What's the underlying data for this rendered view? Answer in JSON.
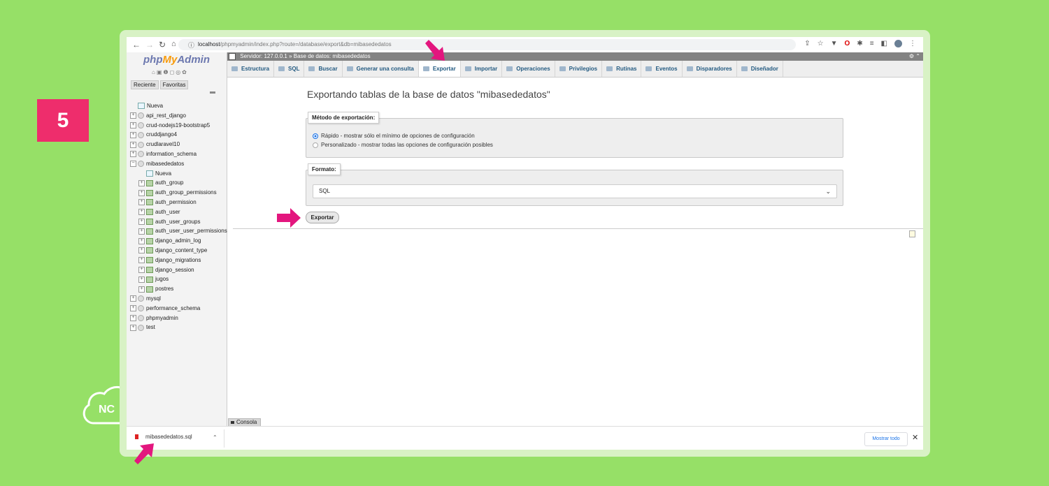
{
  "step_number": "5",
  "brand": {
    "logo_text": "NC"
  },
  "browser": {
    "url_host": "localhost",
    "url_path": "/phpmyadmin/index.php?route=/database/export&db=mibasededatos"
  },
  "sidebar": {
    "logo_php": "php",
    "logo_my": "My",
    "logo_admin": "Admin",
    "tabs": [
      "Reciente",
      "Favoritas"
    ],
    "tree": [
      {
        "label": "Nueva",
        "kind": "new",
        "level": 0
      },
      {
        "label": "api_rest_django",
        "kind": "db",
        "level": 0
      },
      {
        "label": "crud-nodejs19-bootstrap5",
        "kind": "db",
        "level": 0
      },
      {
        "label": "cruddjango4",
        "kind": "db",
        "level": 0
      },
      {
        "label": "crudlaravel10",
        "kind": "db",
        "level": 0
      },
      {
        "label": "information_schema",
        "kind": "db",
        "level": 0
      },
      {
        "label": "mibasededatos",
        "kind": "db",
        "level": 0,
        "expanded": true
      },
      {
        "label": "Nueva",
        "kind": "new",
        "level": 1
      },
      {
        "label": "auth_group",
        "kind": "table",
        "level": 1
      },
      {
        "label": "auth_group_permissions",
        "kind": "table",
        "level": 1
      },
      {
        "label": "auth_permission",
        "kind": "table",
        "level": 1
      },
      {
        "label": "auth_user",
        "kind": "table",
        "level": 1
      },
      {
        "label": "auth_user_groups",
        "kind": "table",
        "level": 1
      },
      {
        "label": "auth_user_user_permissions",
        "kind": "table",
        "level": 1
      },
      {
        "label": "django_admin_log",
        "kind": "table",
        "level": 1
      },
      {
        "label": "django_content_type",
        "kind": "table",
        "level": 1
      },
      {
        "label": "django_migrations",
        "kind": "table",
        "level": 1
      },
      {
        "label": "django_session",
        "kind": "table",
        "level": 1
      },
      {
        "label": "jugos",
        "kind": "table",
        "level": 1
      },
      {
        "label": "postres",
        "kind": "table",
        "level": 1
      },
      {
        "label": "mysql",
        "kind": "db",
        "level": 0
      },
      {
        "label": "performance_schema",
        "kind": "db",
        "level": 0
      },
      {
        "label": "phpmyadmin",
        "kind": "db",
        "level": 0
      },
      {
        "label": "test",
        "kind": "db",
        "level": 0
      }
    ]
  },
  "breadcrumb": {
    "server": "Servidor: 127.0.0.1",
    "separator": "»",
    "database": "Base de datos: mibasededatos"
  },
  "tabs": [
    "Estructura",
    "SQL",
    "Buscar",
    "Generar una consulta",
    "Exportar",
    "Importar",
    "Operaciones",
    "Privilegios",
    "Rutinas",
    "Eventos",
    "Disparadores",
    "Diseñador"
  ],
  "active_tab": "Exportar",
  "main": {
    "title": "Exportando tablas de la base de datos \"mibasededatos\"",
    "method_legend": "Método de exportación:",
    "options": [
      {
        "label": "Rápido - mostrar sólo el mínimo de opciones de configuración",
        "checked": true
      },
      {
        "label": "Personalizado - mostrar todas las opciones de configuración posibles",
        "checked": false
      }
    ],
    "format_legend": "Formato:",
    "format_value": "SQL",
    "export_button": "Exportar"
  },
  "console_label": "Consola",
  "download_bar": {
    "filename": "mibasededatos.sql",
    "show_all": "Mostrar todo"
  },
  "colors": {
    "background": "#96e067",
    "badge": "#ee2d6c",
    "arrow": "#e3167e",
    "link": "#235a81"
  }
}
